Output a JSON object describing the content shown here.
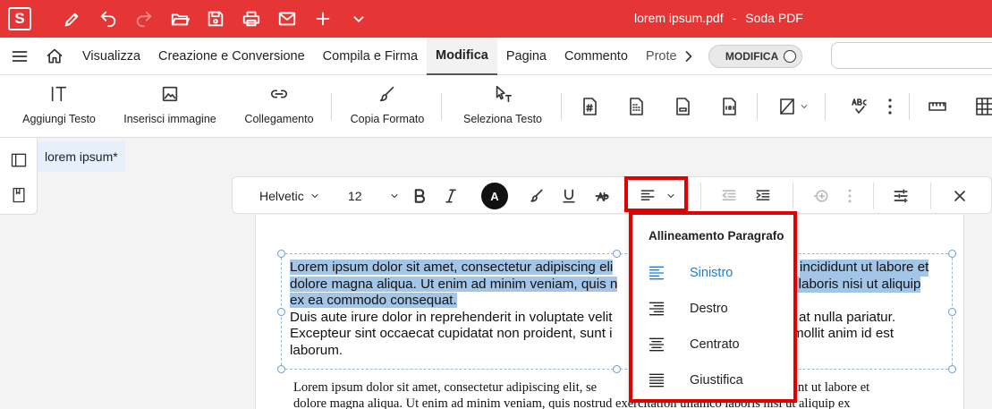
{
  "app": {
    "logo_letter": "S",
    "filename": "lorem ipsum.pdf",
    "separator": "-",
    "app_name": "Soda PDF"
  },
  "colors": {
    "titlebar": "#e63535",
    "accent": "#1a7fd4",
    "highlight": "#a3c6e8",
    "annotation_box": "#e00000"
  },
  "quick_access": [
    "edit-pen-icon",
    "undo-icon",
    "redo-icon",
    "open-folder-icon",
    "save-icon",
    "print-icon",
    "mail-icon",
    "plus-icon",
    "chevron-down-icon"
  ],
  "menu": {
    "tabs": [
      "Visualizza",
      "Creazione e Conversione",
      "Compila e Firma",
      "Modifica",
      "Pagina",
      "Commento",
      "Prote:"
    ],
    "active_tab": "Modifica",
    "toggle_label": "MODIFICA"
  },
  "ribbon": {
    "add_text": "Aggiungi Testo",
    "insert_image": "Inserisci immagine",
    "link": "Collegamento",
    "copy_format": "Copia Formato",
    "select_text": "Seleziona Testo"
  },
  "document_tab": {
    "name": "lorem ipsum",
    "modified_marker": "*"
  },
  "format_toolbar": {
    "font": "Helvetic",
    "size": "12",
    "color_letter": "A"
  },
  "paragraphs": {
    "p1_line1": "Lorem ipsum dolor sit amet, consectetur adipiscing eli",
    "p1_line1_end": "incididunt ut labore et",
    "p1_line2": "dolore magna aliqua. Ut enim ad minim veniam, quis n",
    "p1_line2_end": "o laboris nisi ut aliquip",
    "p1_line3": "ex ea commodo consequat.",
    "p2_line1": "Duis aute irure dolor in reprehenderit in voluptate velit",
    "p2_line1_end": "at nulla pariatur.",
    "p2_line2": "Excepteur sint occaecat cupidatat non proident, sunt i",
    "p2_line2_end": "mollit anim id est",
    "p2_line3": "laborum.",
    "serif_line1": "Lorem ipsum dolor sit amet, consectetur adipiscing elit, se",
    "serif_line1_end": "int ut labore et",
    "serif_line2": "dolore magna aliqua. Ut enim ad minim veniam, quis nostrud exercitation ullamco laboris nisi ut aliquip ex"
  },
  "dropdown": {
    "title": "Allineamento Paragrafo",
    "items": [
      {
        "label": "Sinistro",
        "icon": "align-left-icon",
        "selected": true
      },
      {
        "label": "Destro",
        "icon": "align-right-icon",
        "selected": false
      },
      {
        "label": "Centrato",
        "icon": "align-center-icon",
        "selected": false
      },
      {
        "label": "Giustifica",
        "icon": "align-justify-icon",
        "selected": false
      }
    ]
  }
}
